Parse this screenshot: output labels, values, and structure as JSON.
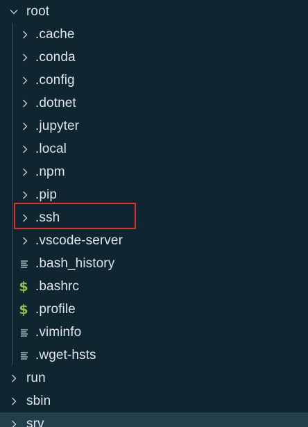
{
  "explorer": {
    "root": {
      "label": "root",
      "expanded": true
    },
    "children": [
      {
        "label": ".cache",
        "kind": "folder",
        "icon": "chevron-right-icon"
      },
      {
        "label": ".conda",
        "kind": "folder",
        "icon": "chevron-right-icon"
      },
      {
        "label": ".config",
        "kind": "folder",
        "icon": "chevron-right-icon"
      },
      {
        "label": ".dotnet",
        "kind": "folder",
        "icon": "chevron-right-icon"
      },
      {
        "label": ".jupyter",
        "kind": "folder",
        "icon": "chevron-right-icon"
      },
      {
        "label": ".local",
        "kind": "folder",
        "icon": "chevron-right-icon"
      },
      {
        "label": ".npm",
        "kind": "folder",
        "icon": "chevron-right-icon"
      },
      {
        "label": ".pip",
        "kind": "folder",
        "icon": "chevron-right-icon"
      },
      {
        "label": ".ssh",
        "kind": "folder",
        "icon": "chevron-right-icon",
        "highlighted": true
      },
      {
        "label": ".vscode-server",
        "kind": "folder",
        "icon": "chevron-right-icon"
      },
      {
        "label": ".bash_history",
        "kind": "file",
        "icon": "text-file-icon"
      },
      {
        "label": ".bashrc",
        "kind": "shell-file",
        "icon": "dollar-file-icon"
      },
      {
        "label": ".profile",
        "kind": "shell-file",
        "icon": "dollar-file-icon"
      },
      {
        "label": ".viminfo",
        "kind": "file",
        "icon": "text-file-icon"
      },
      {
        "label": ".wget-hsts",
        "kind": "file",
        "icon": "text-file-icon"
      }
    ],
    "siblings": [
      {
        "label": "run",
        "kind": "folder",
        "icon": "chevron-right-icon"
      },
      {
        "label": "sbin",
        "kind": "folder",
        "icon": "chevron-right-icon"
      },
      {
        "label": "srv",
        "kind": "folder",
        "icon": "chevron-right-icon"
      }
    ],
    "colors": {
      "background": "#0f2530",
      "text": "#dfe6e9",
      "shell_icon": "#8fc24a",
      "highlight_border": "#e0302a",
      "selected_row": "#22404c"
    }
  }
}
